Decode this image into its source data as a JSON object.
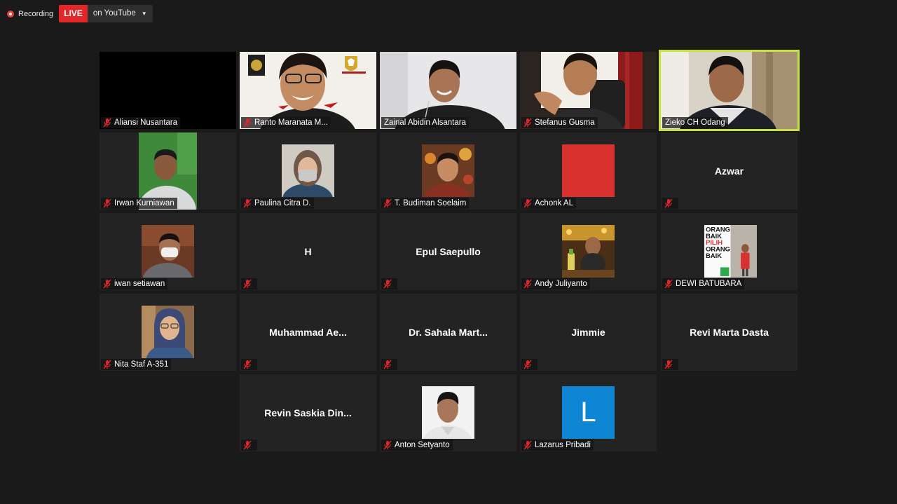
{
  "topbar": {
    "recording_label": "Recording",
    "live_label": "LIVE",
    "destination_label": "on YouTube"
  },
  "participants": [
    {
      "name": "Aliansi Nusantara",
      "display": "video-off-black",
      "muted": true
    },
    {
      "name": "Ranto Maranata M...",
      "display": "video",
      "muted": true
    },
    {
      "name": "Zainal Abidin Alsantara",
      "display": "video",
      "muted": false
    },
    {
      "name": "Stefanus Gusma",
      "display": "video",
      "muted": true
    },
    {
      "name": "Zieko CH Odang",
      "display": "video",
      "muted": false,
      "active_speaker": true
    },
    {
      "name": "Irwan Kurniawan",
      "display": "avatar-photo",
      "muted": true
    },
    {
      "name": "Paulina Citra D.",
      "display": "avatar-photo",
      "muted": true
    },
    {
      "name": "T. Budiman Soelaim",
      "display": "avatar-photo",
      "muted": true
    },
    {
      "name": "Achonk AL",
      "display": "avatar-red",
      "muted": true
    },
    {
      "name": "Azwar",
      "display": "name-only",
      "muted": true
    },
    {
      "name": "iwan setiawan",
      "display": "avatar-photo",
      "muted": true
    },
    {
      "name": "H",
      "display": "name-only",
      "muted": true
    },
    {
      "name": "Epul Saepullo",
      "display": "name-only",
      "muted": true
    },
    {
      "name": "Andy Juliyanto",
      "display": "avatar-photo",
      "muted": true
    },
    {
      "name": "DEWI BATUBARA",
      "display": "avatar-photo",
      "muted": true,
      "avatar_text": [
        "ORANG",
        "BAIK",
        "PILIH",
        "ORANG",
        "BAIK"
      ]
    },
    {
      "name": "Nita Staf A-351",
      "display": "avatar-photo",
      "muted": true
    },
    {
      "name": "Muhammad  Ae...",
      "display": "name-only",
      "muted": true
    },
    {
      "name": "Dr.  Sahala  Mart...",
      "display": "name-only",
      "muted": true
    },
    {
      "name": "Jimmie",
      "display": "name-only",
      "muted": true
    },
    {
      "name": "Revi Marta Dasta",
      "display": "name-only",
      "muted": true
    },
    {
      "name": "Revin  Saskia  Din...",
      "display": "name-only",
      "muted": true
    },
    {
      "name": "Anton Setyanto",
      "display": "avatar-photo",
      "muted": true
    },
    {
      "name": "Lazarus Pribadi",
      "display": "avatar-letter",
      "avatar_letter": "L",
      "muted": true
    }
  ],
  "colors": {
    "background": "#1a1a1a",
    "tile": "#232323",
    "active_speaker_border": "#c7e23a",
    "live_badge": "#e02828",
    "muted_icon": "#e0262a",
    "avatar_red": "#d8312f",
    "avatar_blue": "#0e86d4"
  }
}
